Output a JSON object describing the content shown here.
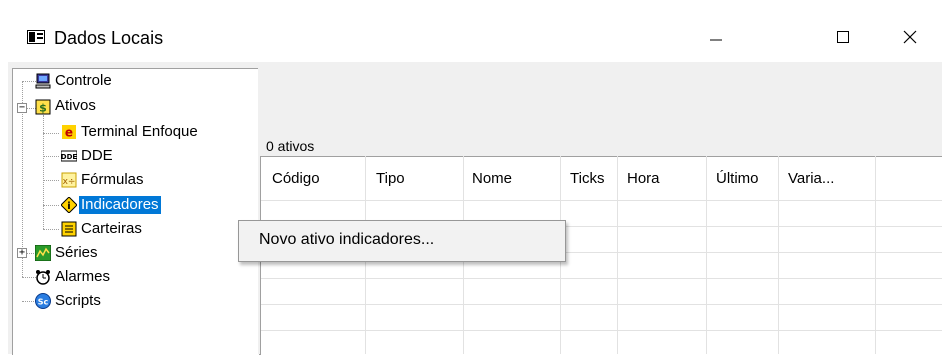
{
  "window": {
    "title": "Dados Locais",
    "minimize_glyph": "—",
    "maximize_glyph": "☐",
    "close_glyph": "✕"
  },
  "tree": {
    "items": [
      {
        "label": "Controle",
        "icon": "monitor-icon"
      },
      {
        "label": "Ativos",
        "icon": "dollar-icon",
        "expander": "−"
      },
      {
        "label": "Terminal Enfoque",
        "icon": "enfoque-e-icon"
      },
      {
        "label": "DDE",
        "icon": "dde-icon"
      },
      {
        "label": "Fórmulas",
        "icon": "formula-icon"
      },
      {
        "label": "Indicadores",
        "icon": "indicator-icon",
        "selected": true
      },
      {
        "label": "Carteiras",
        "icon": "portfolio-icon"
      },
      {
        "label": "Séries",
        "icon": "series-chart-icon",
        "expander": "+"
      },
      {
        "label": "Alarmes",
        "icon": "alarm-clock-icon"
      },
      {
        "label": "Scripts",
        "icon": "script-icon"
      }
    ]
  },
  "main": {
    "status": "0 ativos",
    "columns": [
      "Código",
      "Tipo",
      "Nome",
      "Ticks",
      "Hora",
      "Último",
      "Varia..."
    ]
  },
  "context_menu": {
    "items": [
      "Novo ativo indicadores..."
    ]
  },
  "colors": {
    "selection": "#0078d7",
    "panel_bg": "#f0f0f0",
    "grid_line": "#e2e2e2"
  }
}
